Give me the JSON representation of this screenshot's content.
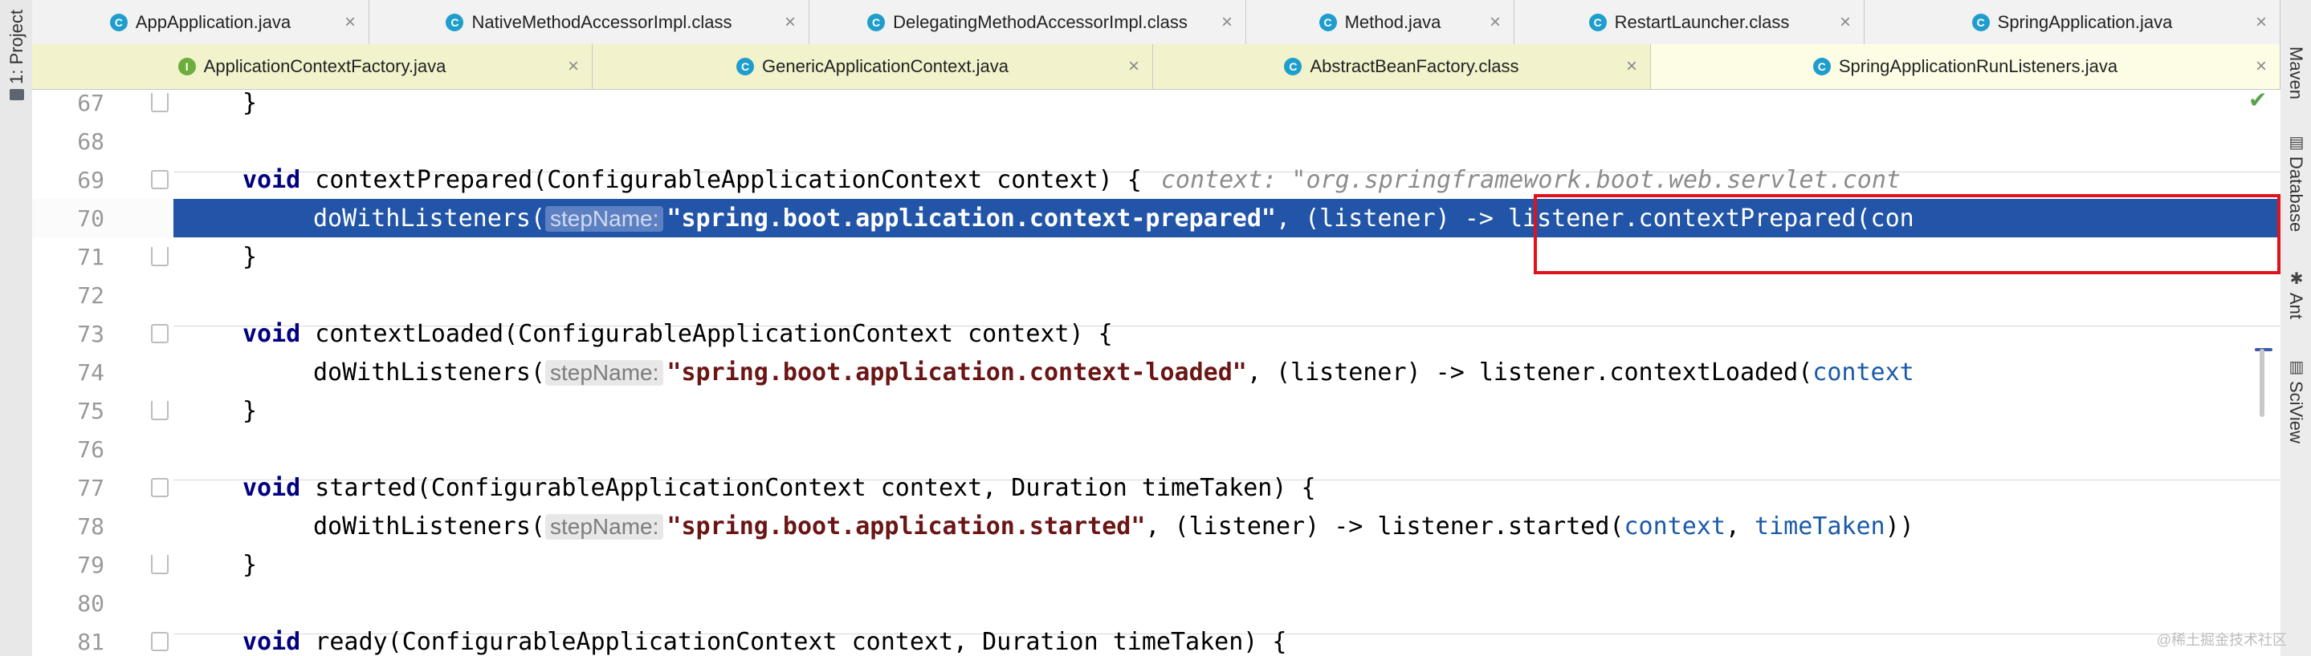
{
  "left_strip": {
    "tab_label": "1: Project"
  },
  "right_strip": {
    "tabs": [
      "Maven",
      "Database",
      "Ant",
      "SciView"
    ]
  },
  "tabs_row1": [
    {
      "label": "AppApplication.java",
      "icon": "C",
      "active": false
    },
    {
      "label": "NativeMethodAccessorImpl.class",
      "icon": "C",
      "active": false
    },
    {
      "label": "DelegatingMethodAccessorImpl.class",
      "icon": "C",
      "active": false
    },
    {
      "label": "Method.java",
      "icon": "C",
      "active": false
    },
    {
      "label": "RestartLauncher.class",
      "icon": "C",
      "active": false
    },
    {
      "label": "SpringApplication.java",
      "icon": "C",
      "active": false
    }
  ],
  "tabs_row2": [
    {
      "label": "ApplicationContextFactory.java",
      "icon": "I",
      "active": false
    },
    {
      "label": "GenericApplicationContext.java",
      "icon": "C",
      "active": false
    },
    {
      "label": "AbstractBeanFactory.class",
      "icon": "C",
      "active": false
    },
    {
      "label": "SpringApplicationRunListeners.java",
      "icon": "C",
      "active": true
    }
  ],
  "code": {
    "l67": {
      "num": "67",
      "close": "}"
    },
    "l68": {
      "num": "68"
    },
    "l69": {
      "num": "69",
      "kw": "void",
      "rest": " contextPrepared(ConfigurableApplicationContext context) {",
      "inlay": "context: \"org.springframework.boot.web.servlet.cont"
    },
    "l70": {
      "num": "70",
      "pre": "doWithListeners(",
      "hint": "stepName:",
      "str": "\"spring.boot.application.context-prepared\"",
      "post": ", (listener) -> listener.contextPrepared(con"
    },
    "l71": {
      "num": "71",
      "close": "}"
    },
    "l72": {
      "num": "72"
    },
    "l73": {
      "num": "73",
      "kw": "void",
      "rest": " contextLoaded(ConfigurableApplicationContext context) {"
    },
    "l74": {
      "num": "74",
      "pre": "doWithListeners(",
      "hint": "stepName:",
      "str": "\"spring.boot.application.context-loaded\"",
      "post": ", (listener) -> listener.contextLoaded(",
      "param": "context"
    },
    "l75": {
      "num": "75",
      "close": "}"
    },
    "l76": {
      "num": "76"
    },
    "l77": {
      "num": "77",
      "kw": "void",
      "rest": " started(ConfigurableApplicationContext context, Duration timeTaken) {"
    },
    "l78": {
      "num": "78",
      "pre": "doWithListeners(",
      "hint": "stepName:",
      "str": "\"spring.boot.application.started\"",
      "post": ", (listener) -> listener.started(",
      "param1": "context",
      "comma": ", ",
      "param2": "timeTaken",
      "end": "))"
    },
    "l79": {
      "num": "79",
      "close": "}"
    },
    "l80": {
      "num": "80"
    },
    "l81": {
      "num": "81",
      "kw": "void",
      "rest": " ready(ConfigurableApplicationContext context, Duration timeTaken) {"
    }
  },
  "watermark": "@稀土掘金技术社区",
  "colors": {
    "selection": "#2255a8",
    "highlight_box": "#e0121b",
    "tab_row2_bg": "#f2f2cc"
  }
}
